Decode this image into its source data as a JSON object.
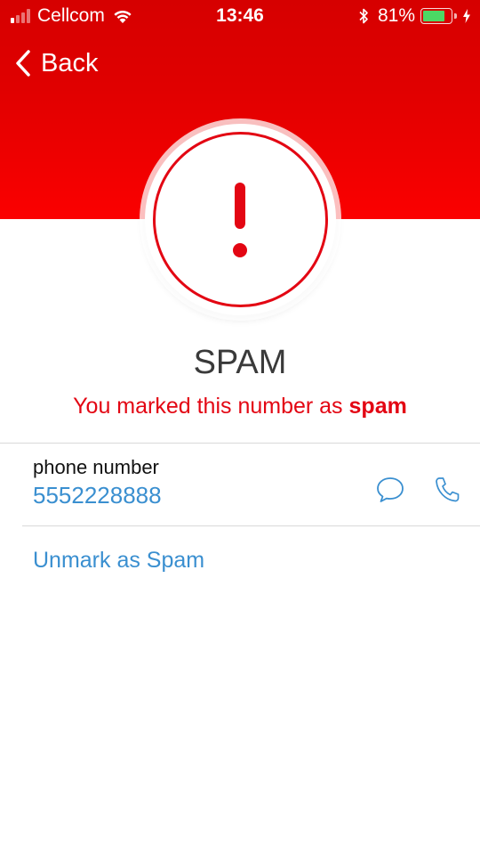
{
  "status_bar": {
    "carrier": "Cellcom",
    "time": "13:46",
    "battery_percent": "81%",
    "battery_level": 0.81,
    "signal_bars_active": 1,
    "signal_bars_total": 4,
    "icons": [
      "signal-icon",
      "wifi-icon",
      "bluetooth-icon",
      "battery-icon",
      "charging-icon"
    ]
  },
  "nav": {
    "back_label": "Back",
    "back_icon": "chevron-left-icon"
  },
  "alert": {
    "icon": "exclamation-icon",
    "title": "SPAM",
    "subtitle_prefix": "You marked this number as ",
    "subtitle_emphasis": "spam"
  },
  "contact": {
    "label": "phone number",
    "value": "5552228888",
    "actions": [
      {
        "name": "message",
        "icon": "message-bubble-icon"
      },
      {
        "name": "call",
        "icon": "phone-icon"
      }
    ]
  },
  "actions": {
    "unmark_label": "Unmark as Spam"
  },
  "colors": {
    "header_red": "#e00000",
    "accent_red": "#e30613",
    "link_blue": "#3a8fd0",
    "title_gray": "#3a3a3a",
    "battery_green": "#4cd964"
  }
}
